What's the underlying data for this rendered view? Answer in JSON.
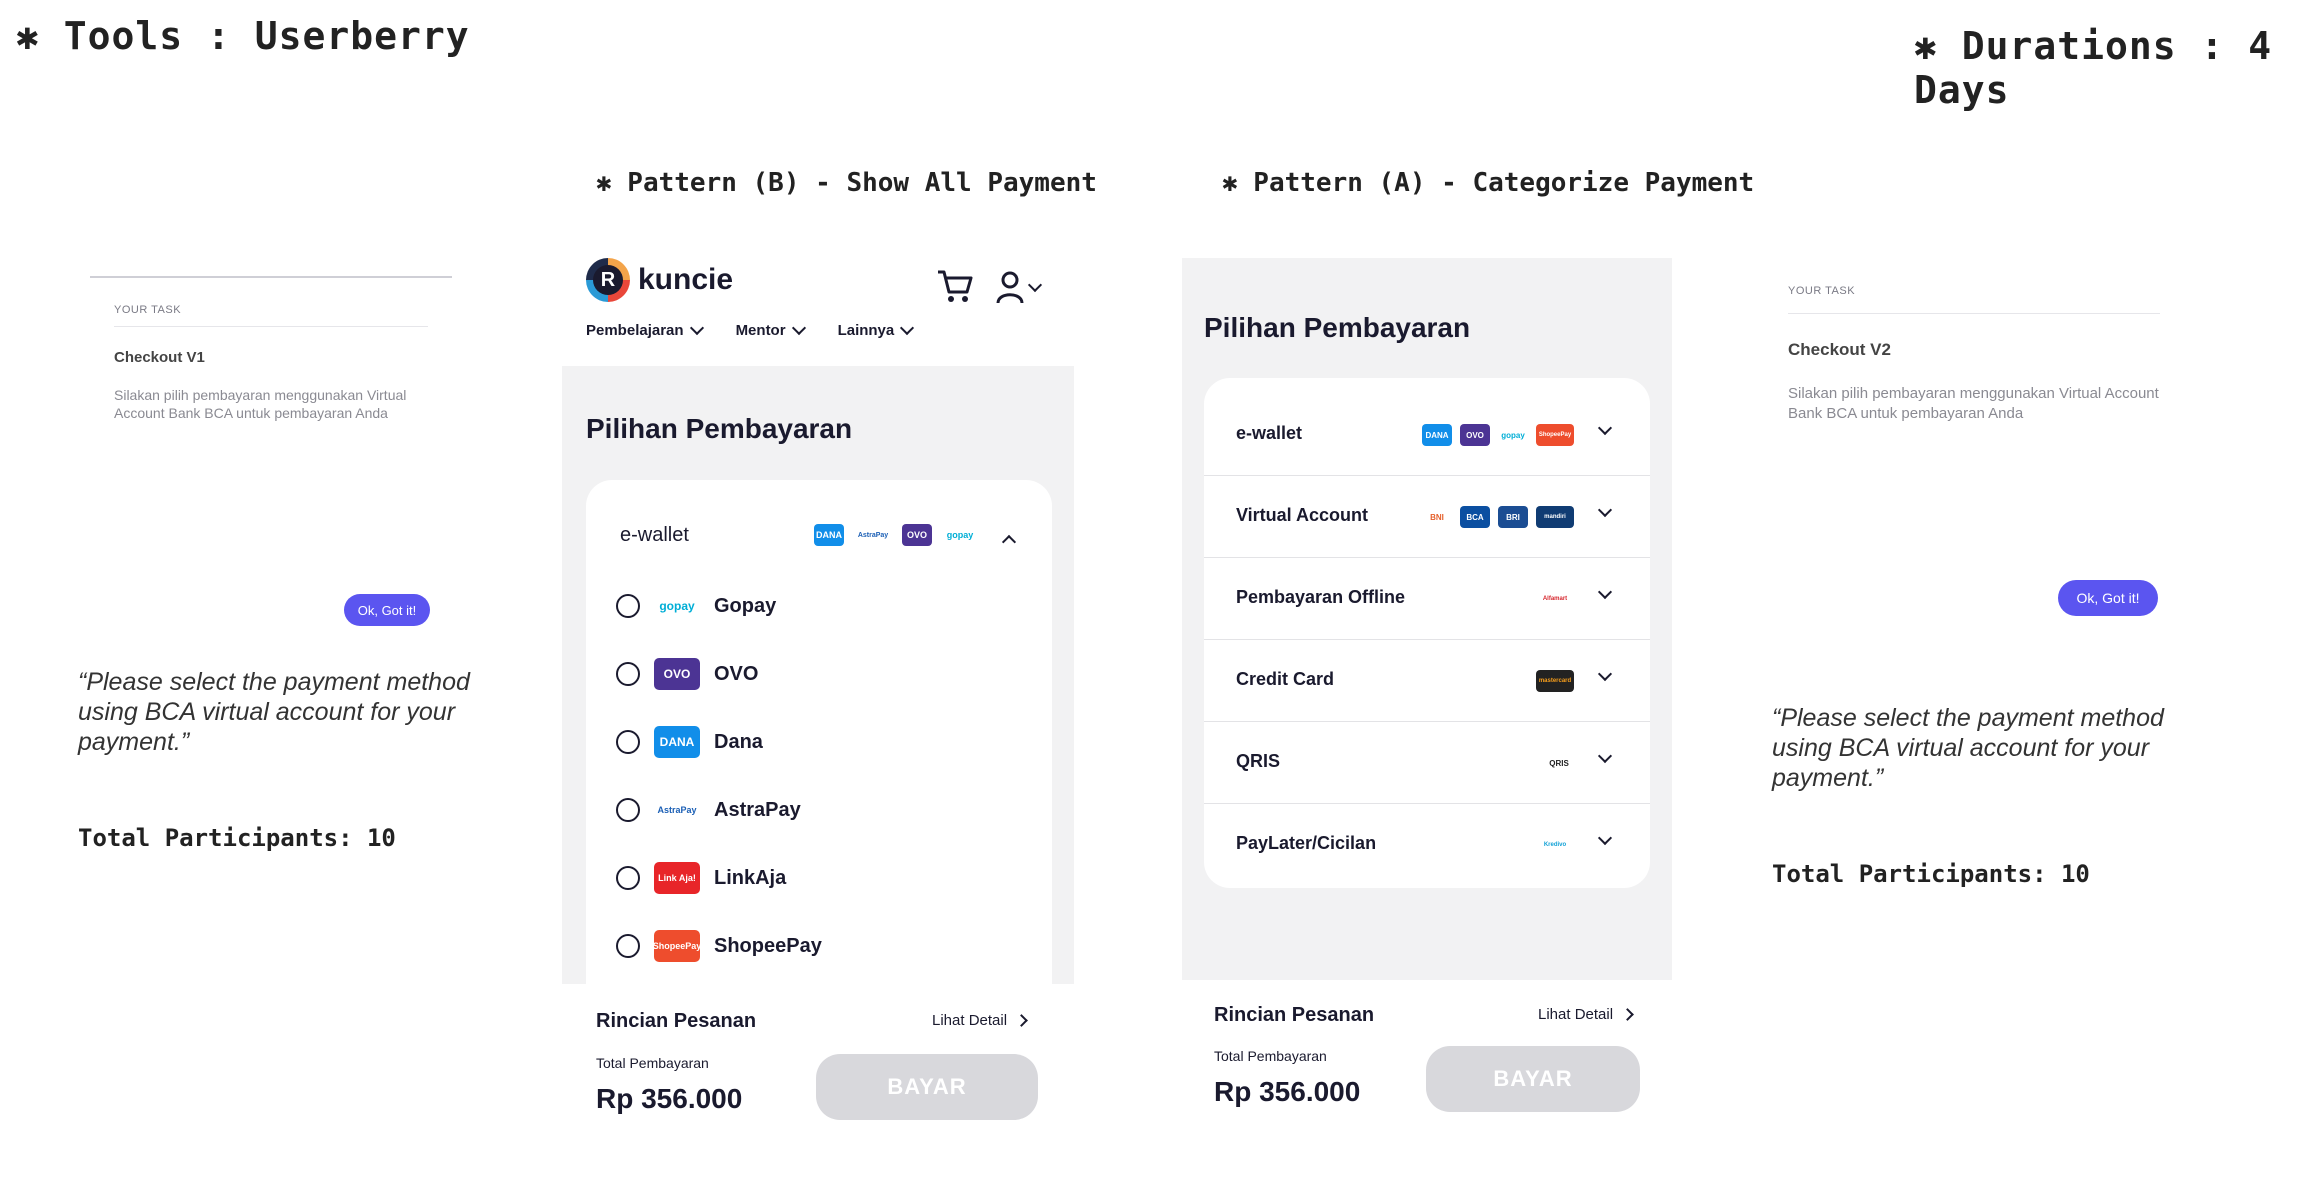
{
  "header": {
    "tools": "✱ Tools : Userberry",
    "durations": "✱ Durations : 4 Days"
  },
  "patterns": {
    "b_title": "✱ Pattern (B) - Show All Payment",
    "a_title": "✱ Pattern (A) - Categorize Payment"
  },
  "task_v1": {
    "label": "YOUR TASK",
    "title": "Checkout V1",
    "desc": "Silakan pilih pembayaran menggunakan Virtual Account Bank BCA untuk pembayaran Anda",
    "button": "Ok, Got it!",
    "quote": "“Please select the payment method using BCA virtual account for your payment.”",
    "participants": "Total Participants: 10"
  },
  "task_v2": {
    "label": "YOUR TASK",
    "title": "Checkout V2",
    "desc": "Silakan pilih pembayaran menggunakan Virtual Account Bank BCA untuk pembayaran Anda",
    "button": "Ok, Got it!",
    "quote": "“Please select the payment method using BCA virtual account for your payment.”",
    "participants": "Total Participants: 10"
  },
  "mock_b": {
    "brand": "kuncie",
    "logo_letter": "R",
    "nav": [
      "Pembelajaran",
      "Mentor",
      "Lainnya"
    ],
    "page_title": "Pilihan Pembayaran",
    "ewallet_label": "e-wallet",
    "ewallet_logos": [
      "DANA",
      "AstraPay",
      "OVO",
      "gopay"
    ],
    "options": [
      {
        "name": "Gopay",
        "logo": "gopay",
        "color": "#ffffff",
        "text_color": "#00aed6"
      },
      {
        "name": "OVO",
        "logo": "OVO",
        "color": "#4c3494",
        "text_color": "#ffffff"
      },
      {
        "name": "Dana",
        "logo": "DANA",
        "color": "#118ee9",
        "text_color": "#ffffff"
      },
      {
        "name": "AstraPay",
        "logo": "AstraPay",
        "color": "#ffffff",
        "text_color": "#1b5fb5"
      },
      {
        "name": "LinkAja",
        "logo": "Link Aja!",
        "color": "#e82529",
        "text_color": "#ffffff"
      },
      {
        "name": "ShopeePay",
        "logo": "ShopeePay",
        "color": "#ee4d2d",
        "text_color": "#ffffff"
      }
    ],
    "rincian": "Rincian Pesanan",
    "lihat": "Lihat Detail",
    "total_label": "Total Pembayaran",
    "total": "Rp 356.000",
    "pay_button": "BAYAR"
  },
  "mock_a": {
    "page_title": "Pilihan Pembayaran",
    "rows": [
      {
        "label": "e-wallet",
        "logos": [
          "DANA",
          "OVO",
          "gopay",
          "ShopeePay"
        ]
      },
      {
        "label": "Virtual Account",
        "logos": [
          "BNI",
          "BCA",
          "BRI",
          "mandiri"
        ]
      },
      {
        "label": "Pembayaran Offline",
        "logos": [
          "Alfamart"
        ]
      },
      {
        "label": "Credit Card",
        "logos": [
          "mastercard"
        ]
      },
      {
        "label": "QRIS",
        "logos": [
          "QRIS"
        ]
      },
      {
        "label": "PayLater/Cicilan",
        "logos": [
          "Kredivo"
        ]
      }
    ],
    "rincian": "Rincian Pesanan",
    "lihat": "Lihat Detail",
    "total_label": "Total Pembayaran",
    "total": "Rp 356.000",
    "pay_button": "BAYAR"
  },
  "colors": {
    "accent": "#5b55f0",
    "panel": "#f2f2f3",
    "disabled": "#d8d8dc",
    "text": "#1a1a2e"
  }
}
